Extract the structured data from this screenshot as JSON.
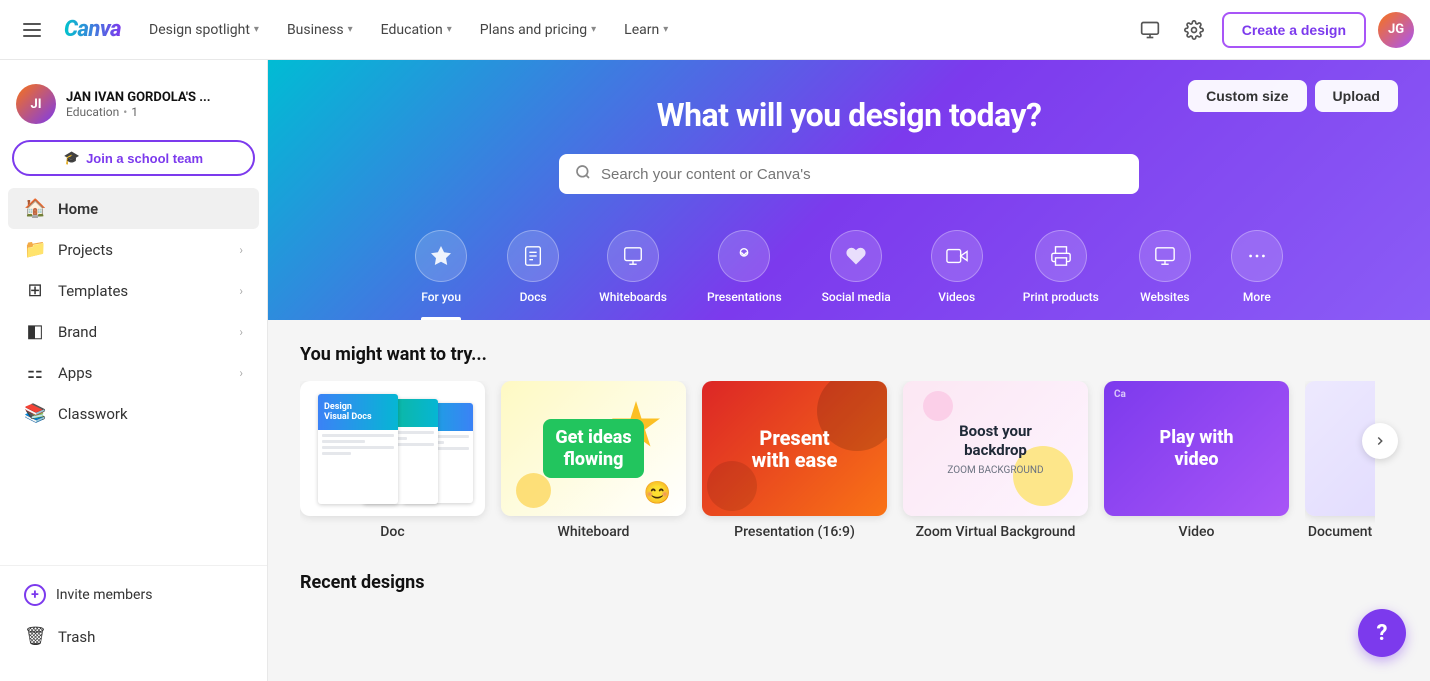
{
  "topNav": {
    "logoText": "Canva",
    "navItems": [
      {
        "label": "Design spotlight",
        "hasChevron": true
      },
      {
        "label": "Business",
        "hasChevron": true
      },
      {
        "label": "Education",
        "hasChevron": true
      },
      {
        "label": "Plans and pricing",
        "hasChevron": true
      },
      {
        "label": "Learn",
        "hasChevron": true
      }
    ],
    "createButtonLabel": "Create a design",
    "avatarInitials": "JG"
  },
  "sidebar": {
    "userName": "JAN IVAN GORDOLA'S ...",
    "userSub": "Education",
    "userDot": "•",
    "userCount": "1",
    "userAvatarInitials": "JI",
    "joinSchoolLabel": "Join a school team",
    "items": [
      {
        "label": "Home",
        "icon": "🏠",
        "active": true
      },
      {
        "label": "Projects",
        "icon": "📁",
        "hasChevron": true
      },
      {
        "label": "Templates",
        "icon": "⊞",
        "hasChevron": true
      },
      {
        "label": "Brand",
        "icon": "◧",
        "hasChevron": true
      },
      {
        "label": "Apps",
        "icon": "⋮⋮",
        "hasChevron": true
      },
      {
        "label": "Classwork",
        "icon": "📚"
      }
    ],
    "inviteLabel": "Invite members",
    "trashLabel": "Trash"
  },
  "hero": {
    "title": "What will you design today?",
    "searchPlaceholder": "Search your content or Canva's",
    "customSizeLabel": "Custom size",
    "uploadLabel": "Upload",
    "quickItems": [
      {
        "label": "For you",
        "icon": "✨",
        "active": true
      },
      {
        "label": "Docs",
        "icon": "📄"
      },
      {
        "label": "Whiteboards",
        "icon": "◻"
      },
      {
        "label": "Presentations",
        "icon": "🏅"
      },
      {
        "label": "Social media",
        "icon": "❤"
      },
      {
        "label": "Videos",
        "icon": "🎬"
      },
      {
        "label": "Print products",
        "icon": "🖨"
      },
      {
        "label": "Websites",
        "icon": "💻"
      },
      {
        "label": "More",
        "icon": "···"
      }
    ]
  },
  "trySection": {
    "title": "You might want to try...",
    "cards": [
      {
        "label": "Doc",
        "thumbType": "doc"
      },
      {
        "label": "Whiteboard",
        "thumbType": "whiteboard"
      },
      {
        "label": "Presentation (16:9)",
        "thumbType": "presentation"
      },
      {
        "label": "Zoom Virtual Background",
        "thumbType": "zoom"
      },
      {
        "label": "Video",
        "thumbType": "video"
      },
      {
        "label": "Document",
        "thumbType": "doc2"
      }
    ]
  },
  "recentSection": {
    "title": "Recent designs"
  },
  "help": {
    "label": "?"
  }
}
